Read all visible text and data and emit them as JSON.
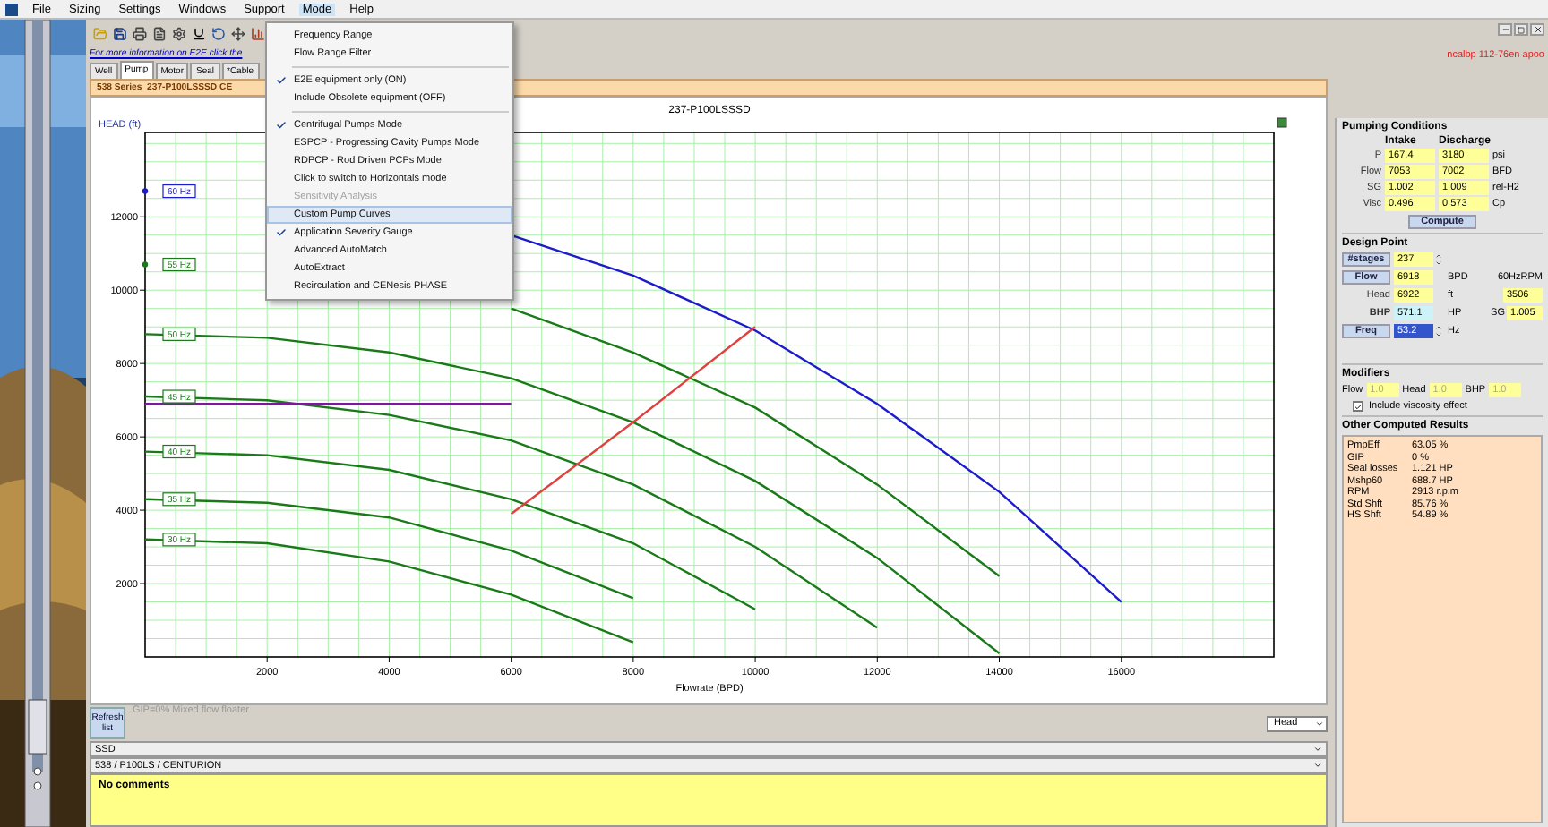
{
  "menubar": [
    {
      "label": "File",
      "selected": false
    },
    {
      "label": "Sizing",
      "selected": false
    },
    {
      "label": "Settings",
      "selected": false
    },
    {
      "label": "Windows",
      "selected": false
    },
    {
      "label": "Support",
      "selected": false
    },
    {
      "label": "Mode",
      "selected": true
    },
    {
      "label": "Help",
      "selected": false
    }
  ],
  "status_text": "ncalbp 112-76en apoo",
  "info_link": "For more information on E2E click the",
  "tabs": [
    {
      "label": "Well",
      "selected": false
    },
    {
      "label": "Pump",
      "selected": true
    },
    {
      "label": "Motor",
      "selected": false
    },
    {
      "label": "Seal",
      "selected": false
    },
    {
      "label": "*Cable",
      "selected": false
    }
  ],
  "series_header": "538 Series  237-P100LSSSD CE",
  "menu": [
    {
      "kind": "item",
      "label": "Frequency Range",
      "checked": false,
      "disabled": false,
      "highlighted": false
    },
    {
      "kind": "item",
      "label": "Flow Range Filter",
      "checked": false,
      "disabled": false,
      "highlighted": false
    },
    {
      "kind": "separator"
    },
    {
      "kind": "item",
      "label": "E2E equipment only (ON)",
      "checked": true,
      "disabled": false,
      "highlighted": false
    },
    {
      "kind": "item",
      "label": "Include Obsolete equipment (OFF)",
      "checked": false,
      "disabled": false,
      "highlighted": false
    },
    {
      "kind": "separator"
    },
    {
      "kind": "item",
      "label": "Centrifugal Pumps Mode",
      "checked": true,
      "disabled": false,
      "highlighted": false
    },
    {
      "kind": "item",
      "label": "ESPCP - Progressing Cavity Pumps Mode",
      "checked": false,
      "disabled": false,
      "highlighted": false
    },
    {
      "kind": "item",
      "label": "RDPCP - Rod Driven PCPs Mode",
      "checked": false,
      "disabled": false,
      "highlighted": false
    },
    {
      "kind": "item",
      "label": "Click to switch to Horizontals mode",
      "checked": false,
      "disabled": false,
      "highlighted": false
    },
    {
      "kind": "item",
      "label": "Sensitivity Analysis",
      "checked": false,
      "disabled": true,
      "highlighted": false
    },
    {
      "kind": "item",
      "label": "Custom Pump Curves",
      "checked": false,
      "disabled": false,
      "highlighted": true
    },
    {
      "kind": "item",
      "label": "Application Severity Gauge",
      "checked": true,
      "disabled": false,
      "highlighted": false
    },
    {
      "kind": "item",
      "label": "Advanced AutoMatch",
      "checked": false,
      "disabled": false,
      "highlighted": false
    },
    {
      "kind": "item",
      "label": "AutoExtract",
      "checked": false,
      "disabled": false,
      "highlighted": false
    },
    {
      "kind": "item",
      "label": "Recirculation and CENesis PHASE",
      "checked": false,
      "disabled": false,
      "highlighted": false
    }
  ],
  "chart": {
    "chart_data": {
      "type": "line",
      "title": "237-P100LSSSD",
      "xlabel": "Flowrate (BPD)",
      "ylabel": "HEAD (ft)",
      "x": [
        0,
        2000,
        4000,
        6000,
        8000,
        10000,
        12000,
        14000,
        16000
      ],
      "series": [
        {
          "name": "60 Hz",
          "color": "#1c1ccc",
          "values": [
            12700,
            null,
            null,
            11500,
            10400,
            8900,
            6900,
            4500,
            1500
          ]
        },
        {
          "name": "55 Hz",
          "color": "#1a7a1a",
          "values": [
            10700,
            null,
            null,
            9500,
            8300,
            6800,
            4700,
            2200,
            null
          ]
        },
        {
          "name": "50 Hz",
          "color": "#1a7a1a",
          "values": [
            8800,
            8700,
            8300,
            7600,
            6400,
            4800,
            2700,
            100,
            null
          ]
        },
        {
          "name": "45 Hz",
          "color": "#1a7a1a",
          "values": [
            7100,
            7000,
            6600,
            5900,
            4700,
            3000,
            800,
            null,
            null
          ]
        },
        {
          "name": "40 Hz",
          "color": "#1a7a1a",
          "values": [
            5600,
            5500,
            5100,
            4300,
            3100,
            1300,
            null,
            null,
            null
          ]
        },
        {
          "name": "35 Hz",
          "color": "#1a7a1a",
          "values": [
            4300,
            4200,
            3800,
            2900,
            1600,
            null,
            null,
            null,
            null
          ]
        },
        {
          "name": "30 Hz",
          "color": "#1a7a1a",
          "values": [
            3200,
            3100,
            2600,
            1700,
            400,
            null,
            null,
            null,
            null
          ]
        },
        {
          "color": "#7a1a9a",
          "values": [
            6900,
            6900,
            6900,
            6900,
            null,
            null,
            null,
            null,
            null
          ]
        },
        {
          "color": "#e04040",
          "values": [
            null,
            null,
            null,
            3900,
            6400,
            9000,
            null,
            null,
            null
          ]
        }
      ],
      "grid": true,
      "xlim": [
        0,
        18500
      ],
      "ylim": [
        0,
        14300
      ],
      "xticks": [
        2000,
        4000,
        6000,
        8000,
        10000,
        12000,
        14000,
        16000
      ],
      "yticks": [
        2000,
        4000,
        6000,
        8000,
        10000,
        12000
      ]
    }
  },
  "bottom": {
    "refresh_button": "Refresh list",
    "flow_note": "GIP=0%  Mixed flow floater",
    "view_select": "Head",
    "stage_select": "SSD",
    "pump_select": "538 / P100LS / CENTURION",
    "comments": "No comments"
  },
  "pumping_conditions": {
    "title": "Pumping Conditions",
    "columns": [
      "Intake",
      "Discharge"
    ],
    "rows": [
      {
        "label": "P",
        "intake": "167.4",
        "discharge": "3180",
        "unit": "psi"
      },
      {
        "label": "Flow",
        "intake": "7053",
        "discharge": "7002",
        "unit": "BFD"
      },
      {
        "label": "SG",
        "intake": "1.002",
        "discharge": "1.009",
        "unit": "rel-H2"
      },
      {
        "label": "Visc",
        "intake": "0.496",
        "discharge": "0.573",
        "unit": "Cp"
      }
    ],
    "compute_button": "Compute"
  },
  "design_point": {
    "title": "Design Point",
    "rows": [
      {
        "kind": "button",
        "label": "#stages",
        "value": "237",
        "spinner": true,
        "selected": false
      },
      {
        "kind": "button",
        "label": "Flow",
        "value": "6918",
        "unit": "BPD",
        "selected": false
      },
      {
        "kind": "plain",
        "label": "Head",
        "value": "6922",
        "unit": "ft",
        "selected": false
      },
      {
        "kind": "plain",
        "label": "BHP",
        "value": "571.1",
        "unit": "HP",
        "selected": false
      },
      {
        "kind": "button",
        "label": "Freq",
        "value": "53.2",
        "unit": "Hz",
        "spinner": true,
        "selected": true
      }
    ],
    "rpm_label": "60HzRPM",
    "rpm_value": "3506",
    "sg_label": "SG",
    "sg_value": "1.005"
  },
  "modifiers": {
    "title": "Modifiers",
    "fields": [
      {
        "label": "Flow",
        "value": "1.0"
      },
      {
        "label": "Head",
        "value": "1.0"
      },
      {
        "label": "BHP",
        "value": "1.0"
      }
    ],
    "viscosity": {
      "label": "Include viscosity effect",
      "checked": true
    }
  },
  "other_results": {
    "title": "Other Computed Results",
    "rows": [
      {
        "label": "PmpEff",
        "value": "63.05 %"
      },
      {
        "label": "GIP",
        "value": "0 %"
      },
      {
        "label": "Seal losses",
        "value": "1.121 HP"
      },
      {
        "label": "Mshp60",
        "value": "688.7 HP"
      },
      {
        "label": "RPM",
        "value": "2913 r.p.m"
      },
      {
        "label": "Std Shft",
        "value": "85.76 %"
      },
      {
        "label": "HS Shft",
        "value": "54.89 %"
      }
    ]
  }
}
